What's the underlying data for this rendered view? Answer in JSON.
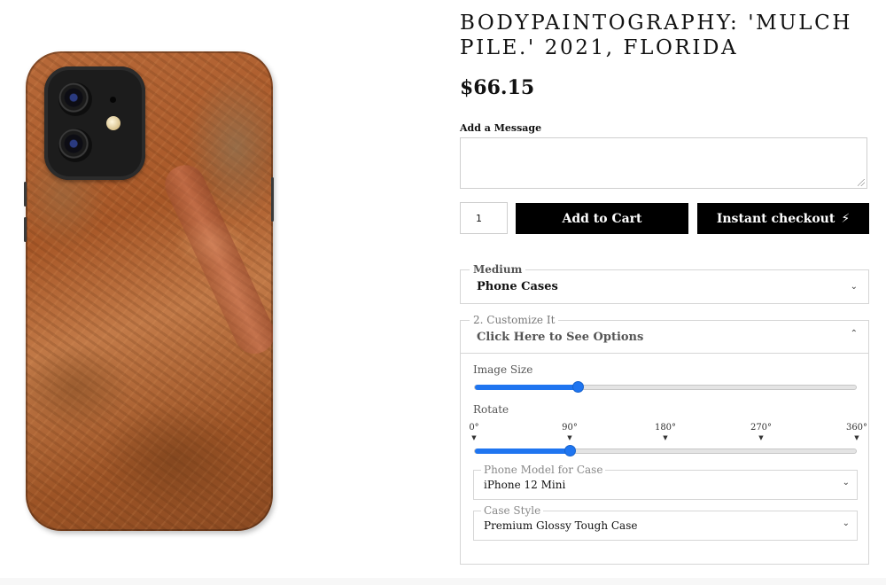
{
  "product": {
    "title": "BODYPAINTOGRAPHY: 'MULCH PILE.' 2021, FLORIDA",
    "price": "$66.15"
  },
  "message": {
    "label": "Add a Message",
    "value": ""
  },
  "cart": {
    "quantity": "1",
    "add_to_cart_label": "Add to Cart",
    "instant_checkout_label": "Instant checkout",
    "instant_checkout_icon": "lightning-bolt-icon"
  },
  "medium": {
    "legend": "Medium",
    "selected": "Phone Cases"
  },
  "customize": {
    "legend": "2. Customize It",
    "toggle_label": "Click Here to See Options"
  },
  "image_size": {
    "label": "Image Size",
    "value_fraction": 0.27
  },
  "rotate": {
    "label": "Rotate",
    "ticks": [
      "0°",
      "90°",
      "180°",
      "270°",
      "360°"
    ],
    "value_degrees": 90,
    "max_degrees": 360
  },
  "phone_model": {
    "legend": "Phone Model for Case",
    "selected": "iPhone 12 Mini"
  },
  "case_style": {
    "legend": "Case Style",
    "selected": "Premium Glossy Tough Case"
  },
  "colors": {
    "button_bg": "#000000",
    "slider_accent": "#1f75f0"
  }
}
